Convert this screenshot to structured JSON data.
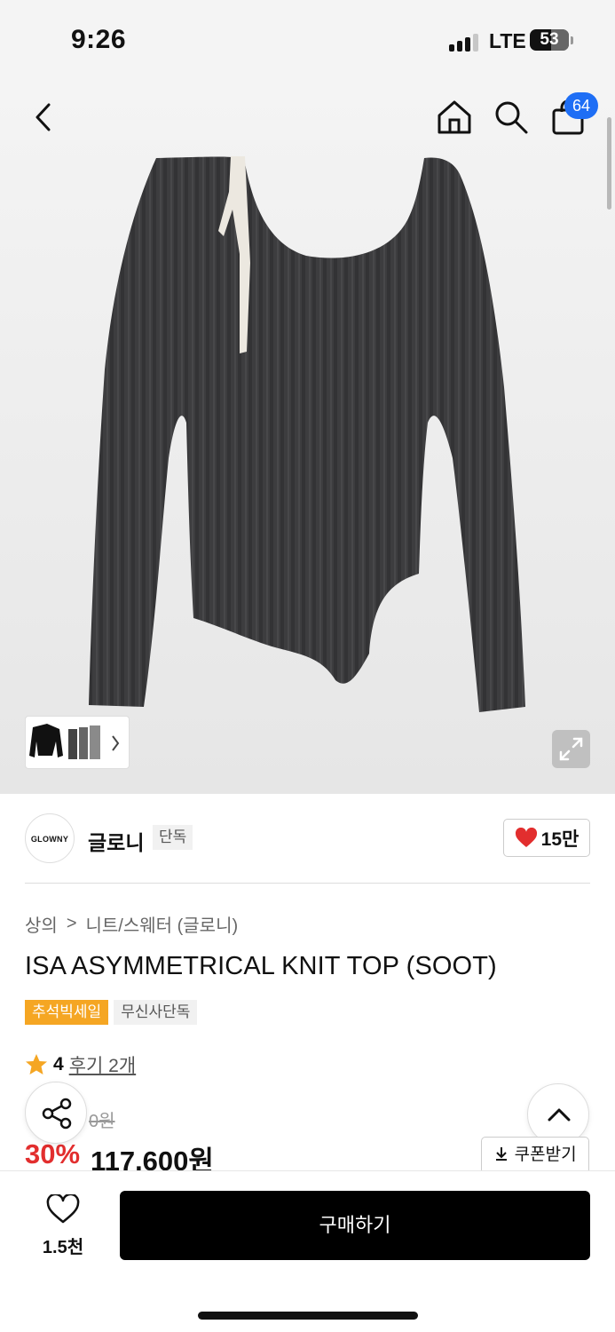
{
  "status_bar": {
    "time": "9:26",
    "network": "LTE",
    "battery": "53"
  },
  "header": {
    "cart_count": "64"
  },
  "brand": {
    "logo_text": "GLOWNY",
    "name": "글로니",
    "tag": "단독",
    "like_count": "15만"
  },
  "breadcrumb": {
    "category": "상의",
    "separator": ">",
    "subcategory": "니트/스웨터 (글로니)"
  },
  "product": {
    "title": "ISA ASYMMETRICAL KNIT TOP (SOOT)",
    "tags": [
      "추석빅세일",
      "무신사단독"
    ],
    "rating": "4",
    "review_text": "후기 2개",
    "original_price": "0원",
    "discount": "30%",
    "price": "117,600원"
  },
  "actions": {
    "coupon_label": "쿠폰받기",
    "wish_count": "1.5천",
    "buy_label": "구매하기"
  },
  "colors": {
    "accent": "#e22e2e",
    "badge": "#1e6ef5",
    "sale_tag": "#f5a623",
    "buy_button": "#000000"
  }
}
